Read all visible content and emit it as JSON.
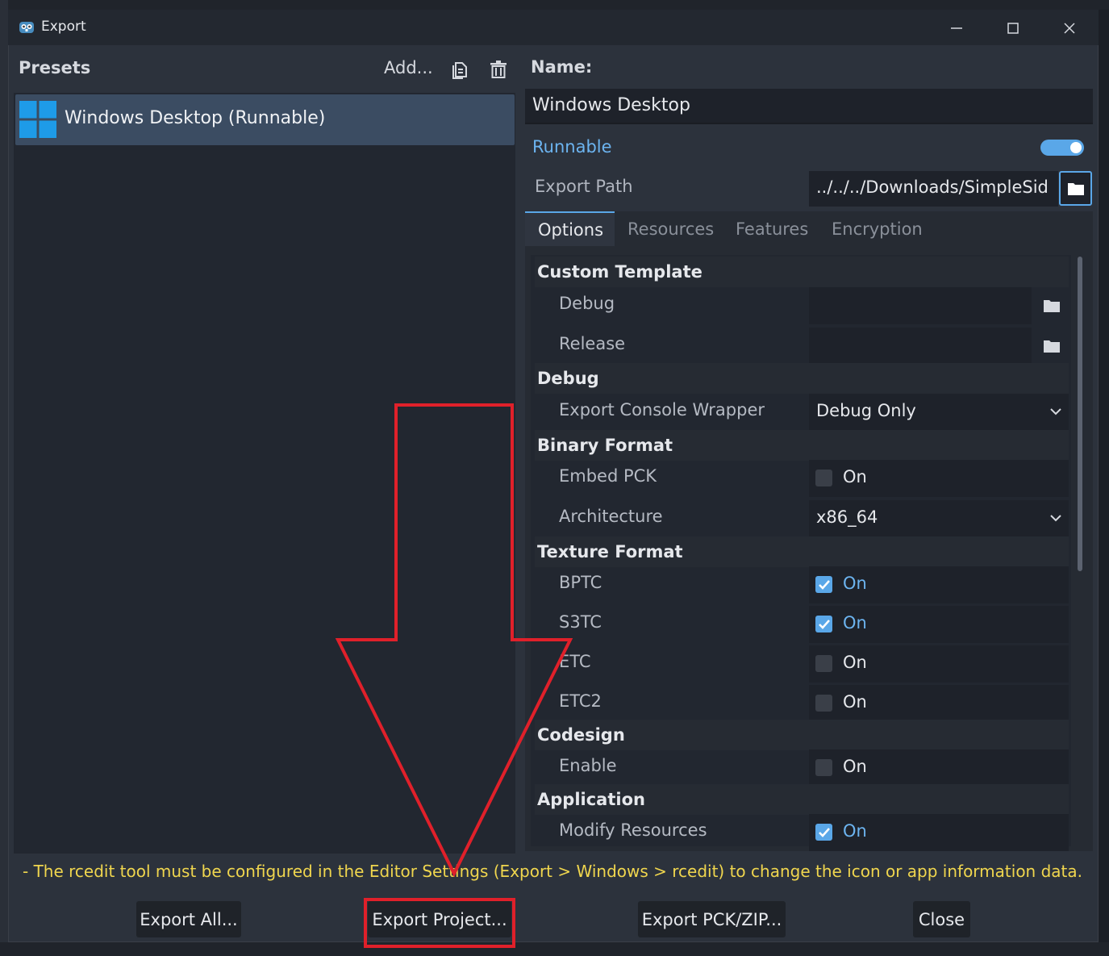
{
  "window": {
    "title": "Export",
    "controls": [
      "minimize",
      "maximize",
      "close"
    ]
  },
  "presets": {
    "label": "Presets",
    "add_label": "Add...",
    "items": [
      {
        "label": "Windows Desktop (Runnable)",
        "icon": "windows-logo-icon"
      }
    ]
  },
  "preset_detail": {
    "name_label": "Name:",
    "name_value": "Windows Desktop",
    "runnable_label": "Runnable",
    "runnable": true,
    "export_path_label": "Export Path",
    "export_path_value": "../../../Downloads/SimpleSid"
  },
  "tabs": [
    {
      "label": "Options",
      "active": true
    },
    {
      "label": "Resources",
      "active": false
    },
    {
      "label": "Features",
      "active": false
    },
    {
      "label": "Encryption",
      "active": false
    }
  ],
  "options": {
    "custom_template": {
      "title": "Custom Template",
      "debug": "Debug",
      "release": "Release"
    },
    "debug": {
      "title": "Debug",
      "console_wrapper_label": "Export Console Wrapper",
      "console_wrapper_value": "Debug Only"
    },
    "binary_format": {
      "title": "Binary Format",
      "embed_pck_label": "Embed PCK",
      "embed_pck_value": "On",
      "architecture_label": "Architecture",
      "architecture_value": "x86_64"
    },
    "texture_format": {
      "title": "Texture Format",
      "bptc_label": "BPTC",
      "bptc_value": "On",
      "s3tc_label": "S3TC",
      "s3tc_value": "On",
      "etc_label": "ETC",
      "etc_value": "On",
      "etc2_label": "ETC2",
      "etc2_value": "On"
    },
    "codesign": {
      "title": "Codesign",
      "enable_label": "Enable",
      "enable_value": "On"
    },
    "application": {
      "title": "Application",
      "modify_resources_label": "Modify Resources",
      "modify_resources_value": "On"
    }
  },
  "warning": "- The rcedit tool must be configured in the Editor Settings (Export > Windows > rcedit) to change the icon or app information data.",
  "buttons": {
    "export_all": "Export All...",
    "export_project": "Export Project...",
    "export_pck_zip": "Export PCK/ZIP...",
    "close": "Close"
  },
  "colors": {
    "accent": "#5aa7e8",
    "warning": "#f0d64e",
    "annotation": "#e0202a"
  }
}
